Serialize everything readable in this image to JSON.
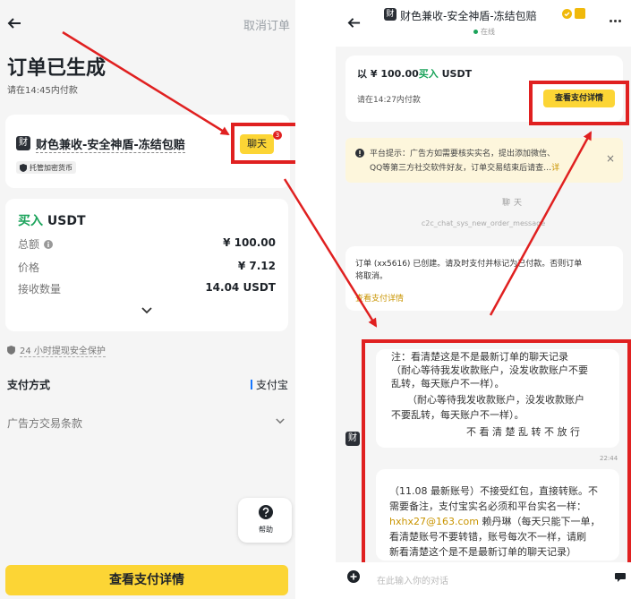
{
  "left": {
    "cancel_order": "取消订单",
    "title": "订单已生成",
    "pay_deadline": "请在14:45内付款",
    "merchant_avatar": "财",
    "merchant_name": "财色兼收-安全神盾-冻结包赔",
    "escrow_badge": "托管加密货币",
    "chat_button": "聊天",
    "chat_unread": "3",
    "order_side": "买入",
    "order_asset": "USDT",
    "rows": [
      {
        "label": "总额",
        "value": "¥ 100.00"
      },
      {
        "label": "价格",
        "value": "¥ 7.12"
      },
      {
        "label": "接收数量",
        "value": "14.04 USDT"
      }
    ],
    "protection": "24 小时提现安全保护",
    "payment_method_label": "支付方式",
    "payment_method_value": "支付宝",
    "ad_terms": "广告方交易条款",
    "help": "帮助",
    "cta": "查看支付详情"
  },
  "right": {
    "merchant_avatar": "财",
    "merchant_name": "财色兼收-安全神盾-冻结包赔",
    "online": "在线",
    "order_summary_prefix": "以 ¥ 100.00",
    "order_summary_side": "买入",
    "order_summary_asset": "USDT",
    "pay_deadline": "请在14:27内付款",
    "view_payment": "查看支付详情",
    "notice_line1": "平台提示：广告方如需要核实实名，提出添加微信、",
    "notice_line2": "QQ等第三方社交软件好友，订单交易结束后请查…",
    "notice_more": "详",
    "chat_label": "聊天",
    "system_message_key": "c2c_chat_sys_new_order_message",
    "order_created_line1": "订单 (xx5616) 已创建。请及时支付并标记为已付款。否则订单",
    "order_created_line2": "将取消。",
    "order_created_link": "查看支付详情",
    "message1": [
      "注：看清楚这是不是最新订单的聊天记录",
      "（耐心等待我发收款账户，没发收款账户不要",
      "乱转，每天账户不一样）。",
      "（耐心等待我发收款账户，没发收款账户",
      "不要乱转，每天账户不一样）。",
      "不 看 清 楚 乱 转 不 放 行"
    ],
    "message_time": "22:44",
    "message2_line1": "（11.08 最新账号）不接受红包，直接转账。不",
    "message2_line2": "需要备注，支付宝实名必须和平台实名一样：",
    "message2_email": "hxhx27@163.com",
    "message2_line3_rest": "赖丹琳（每天只能下一单，",
    "message2_line4": "看清楚账号不要转错，账号每次不一样，请刷",
    "message2_line5": "新看清楚这个是不是最新订单的聊天记录）",
    "input_placeholder": "在此输入你的对话"
  },
  "colors": {
    "accent_yellow": "#fcd535",
    "buy_green": "#1aa35a",
    "annotation_red": "#e02020",
    "link_orange": "#c99400"
  },
  "icons": [
    "back-arrow-icon",
    "info-icon",
    "shield-icon",
    "chevron-down-icon",
    "help-icon",
    "verified-icon",
    "more-icon",
    "warning-icon",
    "close-icon",
    "add-icon",
    "send-icon"
  ]
}
